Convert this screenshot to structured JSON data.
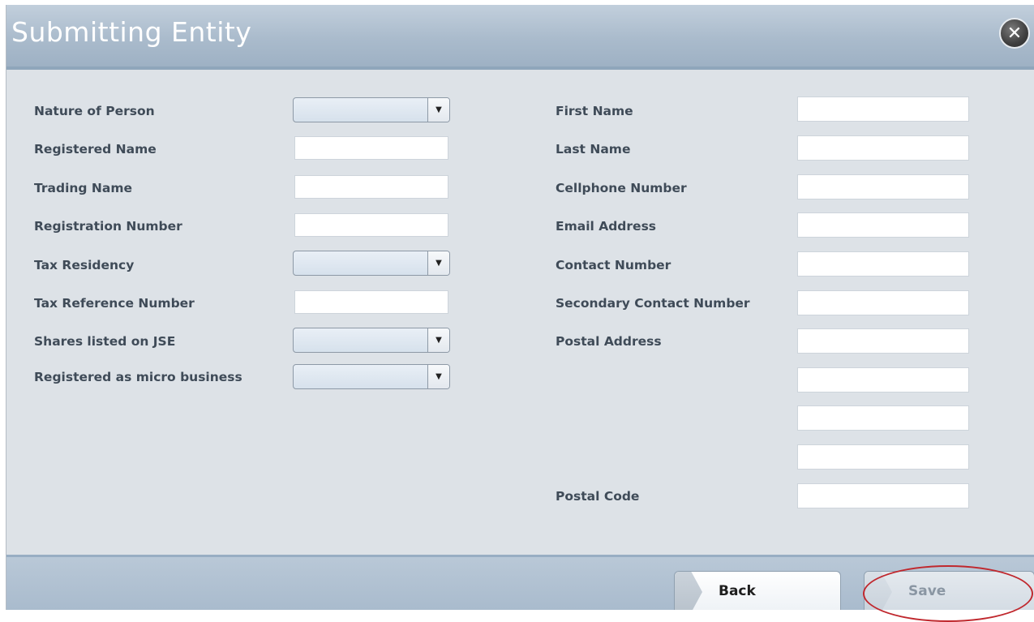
{
  "dialog": {
    "title": "Submitting Entity",
    "close_icon": "close-icon",
    "close_glyph": "✕"
  },
  "left_form": {
    "fields": [
      {
        "label": "Nature of Person",
        "type": "select",
        "value": ""
      },
      {
        "label": "Registered Name",
        "type": "text",
        "value": ""
      },
      {
        "label": "Trading Name",
        "type": "text",
        "value": ""
      },
      {
        "label": "Registration Number",
        "type": "text",
        "value": ""
      },
      {
        "label": "Tax Residency",
        "type": "select",
        "value": ""
      },
      {
        "label": "Tax Reference Number",
        "type": "text",
        "value": ""
      },
      {
        "label": "Shares listed on JSE",
        "type": "select",
        "value": ""
      },
      {
        "label": "Registered as micro business",
        "type": "select",
        "value": ""
      }
    ]
  },
  "right_form": {
    "fields": [
      {
        "label": "First Name",
        "value": ""
      },
      {
        "label": "Last Name",
        "value": ""
      },
      {
        "label": "Cellphone Number",
        "value": ""
      },
      {
        "label": "Email Address",
        "value": ""
      },
      {
        "label": "Contact Number",
        "value": ""
      },
      {
        "label": "Secondary Contact Number",
        "value": ""
      },
      {
        "label": "Postal Address",
        "value": ""
      },
      {
        "label": "",
        "value": ""
      },
      {
        "label": "",
        "value": ""
      },
      {
        "label": "",
        "value": ""
      },
      {
        "label": "Postal Code",
        "value": ""
      }
    ]
  },
  "footer": {
    "back_label": "Back",
    "save_label": "Save",
    "save_state": "disabled"
  },
  "colors": {
    "title_bar": "#aabbcc",
    "body": "#dde2e7",
    "label_text": "#3f4b58",
    "annotation": "#c0282e"
  }
}
